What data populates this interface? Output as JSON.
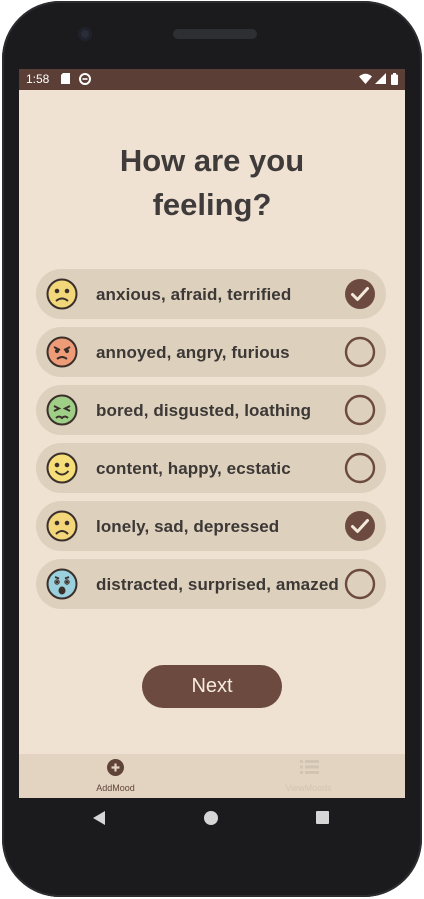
{
  "status_bar": {
    "time": "1:58"
  },
  "title": "How are you\nfeeling?",
  "moods": [
    {
      "label": "anxious, afraid, terrified",
      "checked": true,
      "emoji": "anxious-face-icon",
      "color": "#f2d77a"
    },
    {
      "label": "annoyed, angry, furious",
      "checked": false,
      "emoji": "angry-face-icon",
      "color": "#ee9b78"
    },
    {
      "label": "bored, disgusted, loathing",
      "checked": false,
      "emoji": "disgusted-face-icon",
      "color": "#9fcf87"
    },
    {
      "label": "content, happy, ecstatic",
      "checked": false,
      "emoji": "happy-face-icon",
      "color": "#f6de79"
    },
    {
      "label": "lonely, sad, depressed",
      "checked": true,
      "emoji": "sad-face-icon",
      "color": "#f3d67a"
    },
    {
      "label": "distracted, surprised, amazed",
      "checked": false,
      "emoji": "surprised-face-icon",
      "color": "#9ad0dd"
    }
  ],
  "next_button": {
    "label": "Next"
  },
  "bottom_nav": {
    "add_label": "AddMood",
    "view_label": "ViewMoods"
  },
  "colors": {
    "accent": "#6c4a3f",
    "background": "#efe2d2",
    "row": "#ddd0bd",
    "statusbar": "#5b3e35"
  }
}
